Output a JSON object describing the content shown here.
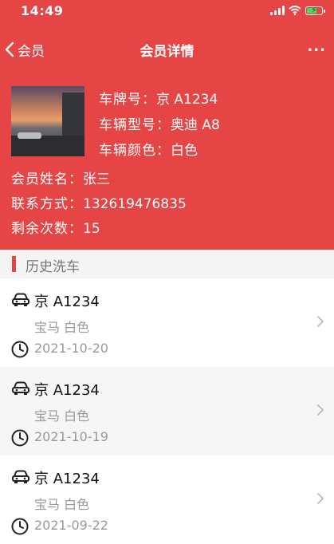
{
  "status_bar": {
    "time": "14:49",
    "battery_level": 0.7
  },
  "nav": {
    "back_label": "会员",
    "title": "会员详情",
    "more_label": "..."
  },
  "vehicle": {
    "plate_label": "车牌号：",
    "plate": "京 A1234",
    "model_label": "车辆型号：",
    "model": "奥迪 A8",
    "color_label": "车辆颜色：",
    "color": "白色"
  },
  "member": {
    "name_label": "会员姓名：",
    "name": "张三",
    "phone_label": "联系方式：",
    "phone": "13261947683 5",
    "remaining_label": "剩余次数：",
    "remaining": "15"
  },
  "history": {
    "title": "历史洗车",
    "records": [
      {
        "plate": "京 A1234",
        "car": "宝马 白色",
        "date": "2021-10-20"
      },
      {
        "plate": "京 A1234",
        "car": "宝马 白色",
        "date": "2021-10-19"
      },
      {
        "plate": "京 A1234",
        "car": "宝马 白色",
        "date": "2021-09-22"
      }
    ]
  },
  "colors": {
    "accent": "#e64545",
    "muted": "#999999"
  }
}
